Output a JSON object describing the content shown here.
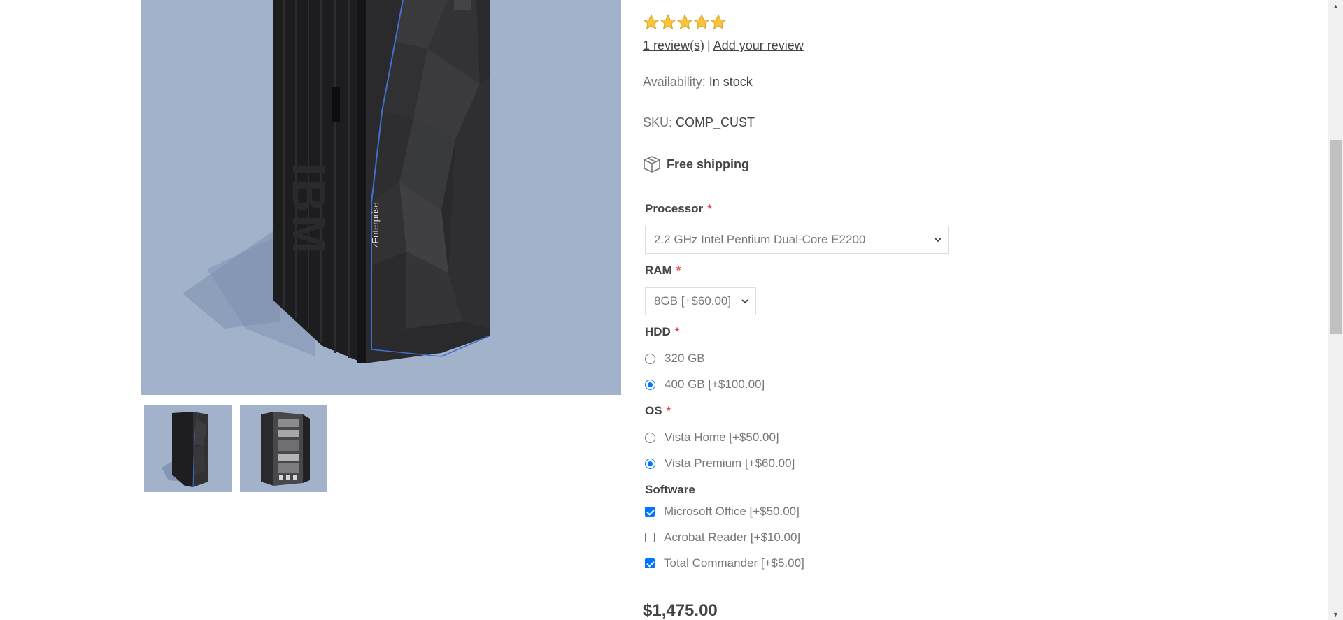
{
  "gallery": {
    "main_image_alt": "IBM z Enterprise mainframe",
    "main_image_brand_text": "IBM",
    "main_image_model_text": "zEnterprise",
    "background_color": "#a3b2cb",
    "thumbnails": [
      {
        "name": "front-view"
      },
      {
        "name": "open-rack-view"
      }
    ]
  },
  "rating": {
    "stars": 5,
    "star_color": "#f7c43b",
    "reviews_link": "1 review(s)",
    "separator": "|",
    "add_review_link": "Add your review"
  },
  "availability": {
    "label": "Availability:",
    "value": "In stock"
  },
  "sku": {
    "label": "SKU:",
    "value": "COMP_CUST"
  },
  "shipping": {
    "icon": "box-icon",
    "text": "Free shipping"
  },
  "attributes": {
    "processor": {
      "label": "Processor",
      "required_mark": "*",
      "selected": "2.2 GHz Intel Pentium Dual-Core E2200"
    },
    "ram": {
      "label": "RAM",
      "required_mark": "*",
      "selected": "8GB [+$60.00]"
    },
    "hdd": {
      "label": "HDD",
      "required_mark": "*",
      "options": [
        {
          "label": "320 GB",
          "checked": false
        },
        {
          "label": "400 GB [+$100.00]",
          "checked": true
        }
      ]
    },
    "os": {
      "label": "OS",
      "required_mark": "*",
      "options": [
        {
          "label": "Vista Home [+$50.00]",
          "checked": false
        },
        {
          "label": "Vista Premium [+$60.00]",
          "checked": true
        }
      ]
    },
    "software": {
      "label": "Software",
      "options": [
        {
          "label": "Microsoft Office [+$50.00]",
          "checked": true
        },
        {
          "label": "Acrobat Reader [+$10.00]",
          "checked": false
        },
        {
          "label": "Total Commander [+$5.00]",
          "checked": true
        }
      ]
    }
  },
  "price": {
    "value": "$1,475.00"
  },
  "colors": {
    "required": "#e4434b",
    "accent": "#0075ff",
    "text": "#444444",
    "muted": "#777777"
  }
}
